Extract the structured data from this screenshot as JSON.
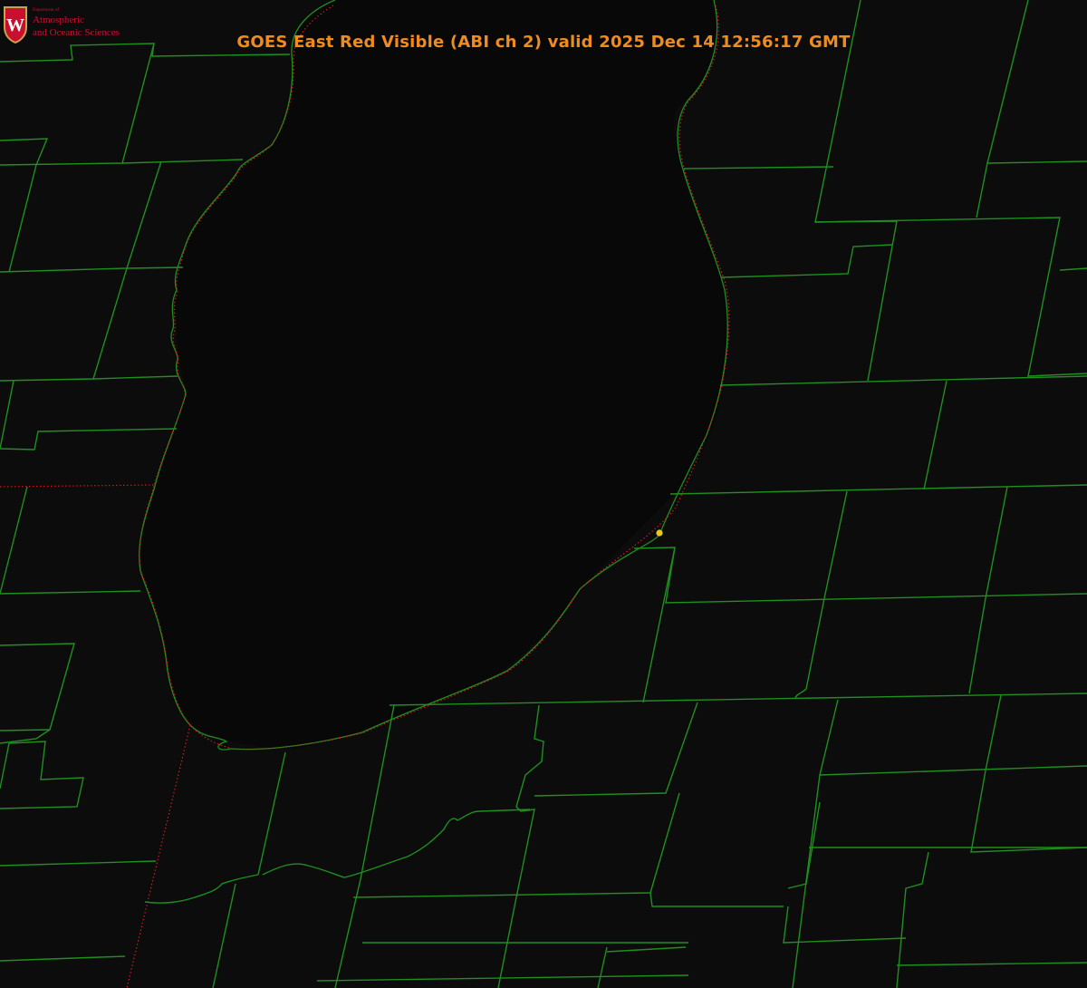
{
  "title": "GOES East Red Visible (ABI ch 2) valid 2025 Dec 14 12:56:17 GMT",
  "logo": {
    "dept_line": "Department of",
    "name_line1": "Atmospheric",
    "name_line2": "and Oceanic Sciences",
    "shield_letter": "W"
  },
  "colors": {
    "background": "#0c0c0c",
    "title": "#f08c1e",
    "county_lines": "#1f8f1f",
    "state_lines": "#d01a1a",
    "marker": "#e6c820",
    "logo_text": "#c8102e"
  },
  "features": {
    "water_body": "lake",
    "marker": "station-dot"
  }
}
